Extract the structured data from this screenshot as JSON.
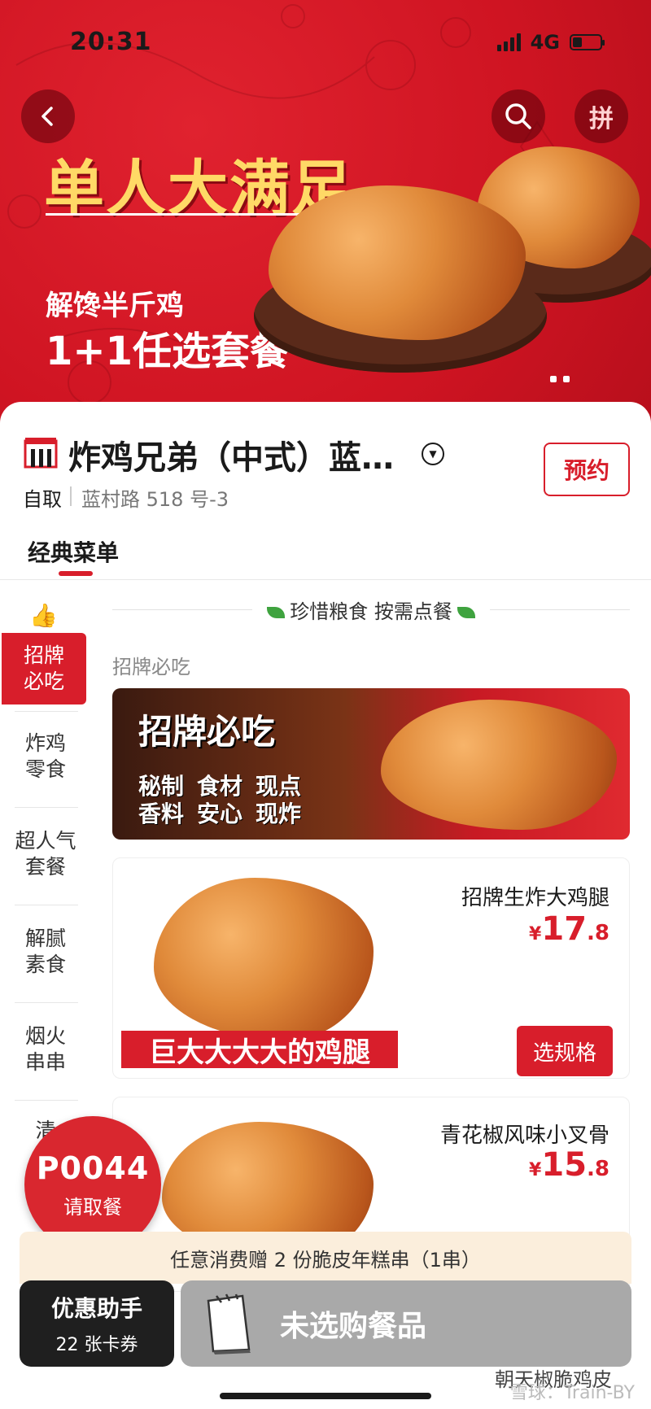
{
  "status_bar": {
    "time": "20:31",
    "network": "4G",
    "battery_level": 0.35
  },
  "banner": {
    "title": "单人大满足",
    "subtitle1": "解馋半斤鸡",
    "subtitle2": "1+1任选套餐",
    "pin_label": "拼",
    "colors": {
      "background": "#d01824",
      "title": "#ffd966"
    }
  },
  "store": {
    "name": "炸鸡兄弟（中式）蓝…",
    "mode": "自取",
    "address": "蓝村路 518 号-3",
    "reserve_label": "预约"
  },
  "menu_tab": {
    "label": "经典菜单"
  },
  "sidebar": {
    "items": [
      {
        "line1": "招牌",
        "line2": "必吃",
        "active": true
      },
      {
        "line1": "炸鸡",
        "line2": "零食",
        "active": false
      },
      {
        "line1": "超人气",
        "line2": "套餐",
        "active": false
      },
      {
        "line1": "解腻",
        "line2": "素食",
        "active": false
      },
      {
        "line1": "烟火",
        "line2": "串串",
        "active": false
      },
      {
        "line1": "清",
        "line2": "",
        "active": false
      }
    ]
  },
  "notice": {
    "text": "珍惜粮食 按需点餐"
  },
  "section": {
    "label": "招牌必吃"
  },
  "promo_banner": {
    "title": "招牌必吃",
    "tag1": "秘制",
    "tag2": "食材",
    "tag3": "现点",
    "tag4": "香料",
    "tag5": "安心",
    "tag6": "现炸"
  },
  "products": [
    {
      "name": "招牌生炸大鸡腿",
      "price_symbol": "¥",
      "price_int": "17",
      "price_dec": ".8",
      "action": "选规格",
      "slogan": "巨大大大大的鸡腿"
    },
    {
      "name": "青花椒风味小叉骨",
      "price_symbol": "¥",
      "price_int": "15",
      "price_dec": ".8"
    }
  ],
  "pickup_badge": {
    "code": "P0044",
    "label": "请取餐"
  },
  "offer": {
    "text": "任意消费赠 2 份脆皮年糕串（1串）"
  },
  "helper": {
    "title": "优惠助手",
    "coupons": "22 张卡券"
  },
  "cart": {
    "text": "未选购餐品"
  },
  "next_product": {
    "name": "朝天椒脆鸡皮"
  },
  "watermark": {
    "text": "雪球：Train-BY"
  },
  "colors": {
    "accent": "#d81e2b",
    "cart_disabled": "#a9a9a9",
    "offer_bg": "#fbeedc"
  }
}
